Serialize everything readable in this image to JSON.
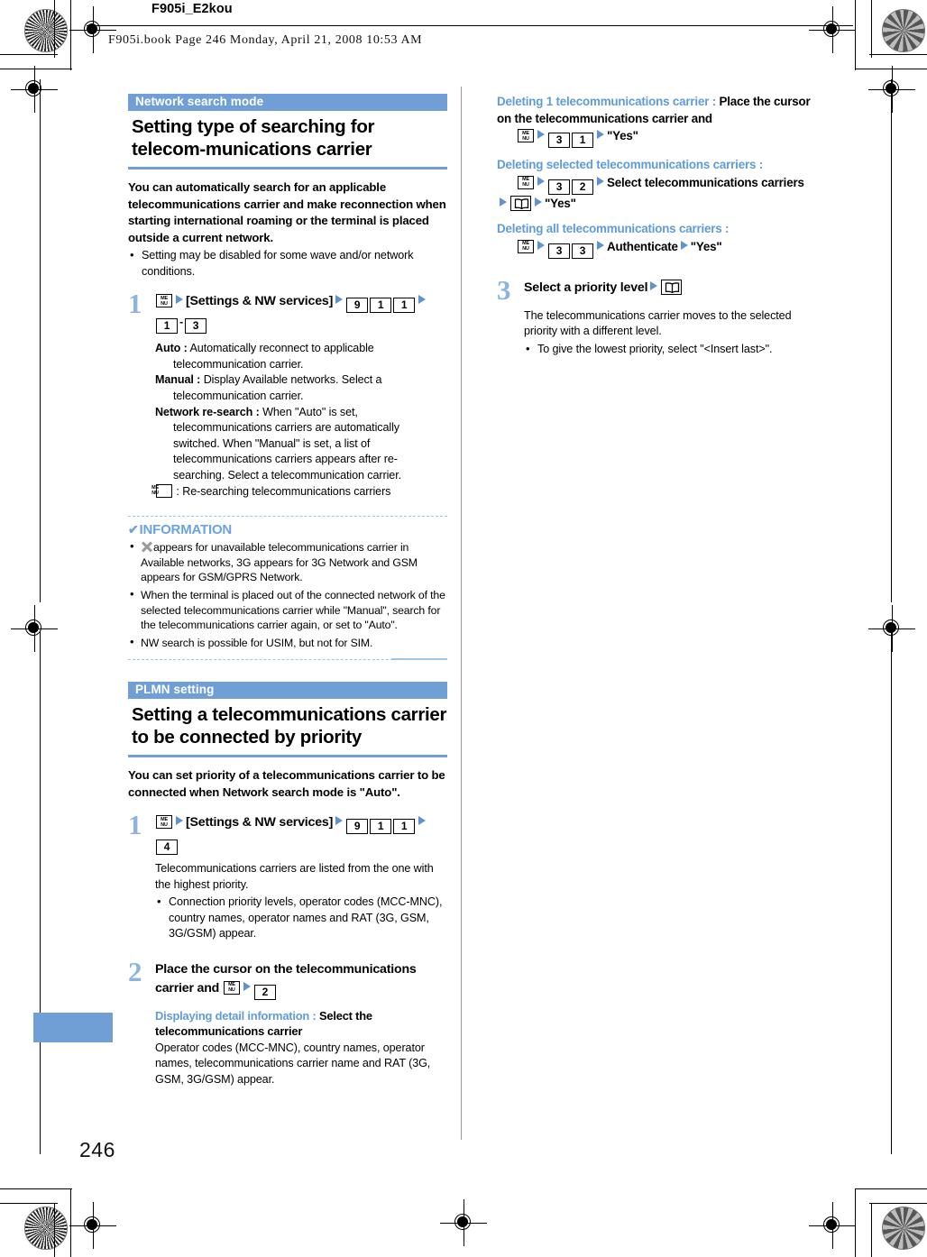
{
  "page": {
    "header_code": "F905i_E2kou",
    "book_line": "F905i.book  Page 246  Monday, April 21, 2008  10:53 AM",
    "page_number": "246"
  },
  "icons": {
    "menu_top": "ME",
    "menu_bottom": "NU",
    "check": "✔",
    "arrow": "arrow-right-icon"
  },
  "colors": {
    "accent_blue": "#6f9fd4",
    "heading_blue": "#5f9bd8",
    "step_number_blue": "#8bb4e0"
  },
  "left_column": {
    "section1": {
      "banner": "Network search mode",
      "title": "Setting type of searching for telecom-munications carrier",
      "lead": "You can automatically search for an applicable telecommunications carrier and make reconnection when starting international roaming or the terminal is placed outside a current network.",
      "lead_bullets": [
        "Setting may be disabled for some wave and/or network conditions."
      ],
      "step1": {
        "number": "1",
        "text_part1": "[Settings & NW services]",
        "keys1": [
          "9",
          "1",
          "1"
        ],
        "keys2": [
          "1",
          "3"
        ],
        "key_separator": "-"
      },
      "definitions": [
        {
          "term": "Auto :",
          "desc": "Automatically reconnect to applicable telecommunication carrier."
        },
        {
          "term": "Manual :",
          "desc": "Display Available networks. Select a telecommunication carrier."
        },
        {
          "term": "Network re-search :",
          "desc": "When \"Auto\" is set, telecommunications carriers are automatically switched. When \"Manual\" is set, a list of telecommunications carriers appears after re-searching. Select a telecommunication carrier."
        }
      ],
      "menu_note": ": Re-searching telecommunications carriers"
    },
    "information": {
      "title": "INFORMATION",
      "items": [
        "appears for unavailable telecommunications carrier in Available networks, 3G appears for 3G Network and GSM appears for GSM/GPRS Network.",
        "When the terminal is placed out of the connected network of the selected telecommunications carrier while \"Manual\", search for the telecommunications carrier again, or set to \"Auto\".",
        "NW search is possible for USIM, but not for SIM."
      ]
    },
    "section2": {
      "banner": "PLMN setting",
      "title": "Setting a telecommunications carrier to be connected by priority",
      "lead": "You can set priority of a telecommunications carrier to be connected when Network search mode is \"Auto\".",
      "step1": {
        "number": "1",
        "text_part1": "[Settings & NW services]",
        "keys1": [
          "9",
          "1",
          "1"
        ],
        "keys2": [
          "4"
        ]
      },
      "step1_note": "Telecommunications carriers are listed from the one with the highest priority.",
      "step1_bullets": [
        "Connection priority levels, operator codes (MCC-MNC), country names, operator names and RAT (3G, GSM, 3G/GSM) appear."
      ],
      "step2": {
        "number": "2",
        "text": "Place the cursor on the telecommunications carrier and",
        "key": "2"
      },
      "detail": {
        "head_blue": "Displaying detail information :",
        "head_black": "Select the telecommunications carrier",
        "body": "Operator codes (MCC-MNC), country names, operator names, telecommunications carrier name and RAT (3G, GSM, 3G/GSM) appear."
      }
    }
  },
  "right_column": {
    "delete_blocks": [
      {
        "head_blue": "Deleting 1 telecommunications carrier :",
        "head_black": "Place the cursor on the telecommunications carrier and",
        "keys": [
          "3",
          "1"
        ],
        "tail": "\"Yes\""
      },
      {
        "head_blue": "Deleting selected telecommunications carriers :",
        "keys": [
          "3",
          "2"
        ],
        "mid": "Select telecommunications carriers",
        "tail": "\"Yes\""
      },
      {
        "head_blue": "Deleting all telecommunications carriers :",
        "keys": [
          "3",
          "3"
        ],
        "mid": "Authenticate",
        "tail": "\"Yes\""
      }
    ],
    "step3": {
      "number": "3",
      "text": "Select a priority level",
      "note": "The telecommunications carrier moves to the selected priority with a different level.",
      "bullets": [
        "To give the lowest priority, select \"<Insert last>\"."
      ]
    }
  }
}
